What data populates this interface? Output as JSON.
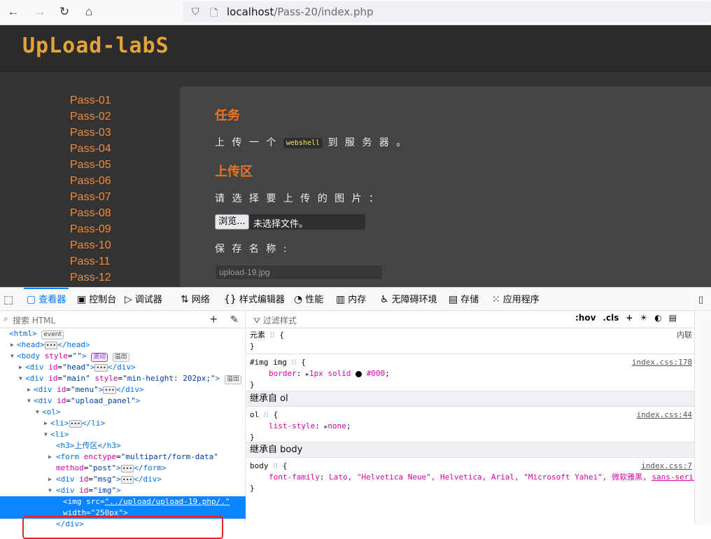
{
  "browser": {
    "url_host": "localhost",
    "url_path": "/Pass-20/index.php"
  },
  "site": {
    "logo": "UpLoad-labS",
    "menu": [
      "Pass-01",
      "Pass-02",
      "Pass-03",
      "Pass-04",
      "Pass-05",
      "Pass-06",
      "Pass-07",
      "Pass-08",
      "Pass-09",
      "Pass-10",
      "Pass-11",
      "Pass-12"
    ],
    "task_heading": "任务",
    "task_text_before": "上 传 一 个",
    "task_code": "webshell",
    "task_text_after": "到 服 务 器 。",
    "upload_heading": "上传区",
    "choose_label": "请 选 择 要 上 传 的 图 片 ：",
    "browse_button": "浏览...",
    "no_file": "未选择文件。",
    "save_name_label": "保 存 名 称 :",
    "save_name_value": "upload-19.jpg"
  },
  "devtools": {
    "tabs": [
      {
        "icon": "▢",
        "label": "查看器"
      },
      {
        "icon": "▣",
        "label": "控制台"
      },
      {
        "icon": "▷",
        "label": "调试器"
      },
      {
        "icon": "⇅",
        "label": "网络"
      },
      {
        "icon": "{}",
        "label": "样式编辑器"
      },
      {
        "icon": "◔",
        "label": "性能"
      },
      {
        "icon": "▥",
        "label": "内存"
      },
      {
        "icon": "♿",
        "label": "无障碍环境"
      },
      {
        "icon": "▤",
        "label": "存储"
      },
      {
        "icon": "⁙",
        "label": "应用程序"
      }
    ],
    "search_placeholder": "搜索 HTML",
    "filter_placeholder": "过滤样式",
    "filter_hov": ":hov",
    "filter_cls": ".cls",
    "tree": {
      "html_tag": "<html>",
      "event_badge": "event",
      "head_open": "<head>",
      "head_close": "</head>",
      "body_open": "<body",
      "body_attr": "style",
      "body_val": "\"\"",
      "body_gt": ">",
      "scroll_badge": "滚动",
      "overflow_badge": "溢出",
      "div": "<div",
      "id_attr": "id",
      "style_attr": "style",
      "head_val": "\"head\"",
      "div_close": "</div>",
      "main_val": "\"main\"",
      "main_style": "\"min-height: 202px;\"",
      "menu_val": "\"menu\"",
      "upload_val": "\"upload_panel\"",
      "ol": "<ol>",
      "li": "<li>",
      "li_close": "</li>",
      "h3": "<h3>上传区</h3>",
      "form_open": "<form",
      "enctype_attr": "enctype",
      "enctype_val": "\"multipart/form-data\"",
      "method_attr": "method",
      "method_val": "\"post\"",
      "form_close": "</form>",
      "msg_val": "\"msg\"",
      "img_val": "\"img\"",
      "img_open": "<img",
      "src_attr": "src",
      "src_val": "\"../upload/upload-19.php/.\"",
      "width_attr": "width",
      "width_val": "\"250px\"",
      "close_div": "</div>"
    },
    "rules": {
      "element_sel": "元素",
      "element_src": "内联",
      "img_sel": "#img img",
      "img_src": "index.css:178",
      "img_prop": "border",
      "img_val": "1px solid",
      "img_color": "#000",
      "inherit_ol": "继承自 ol",
      "ol_sel": "ol",
      "ol_src": "index.css:44",
      "ol_prop": "list-style",
      "ol_val": "none",
      "inherit_body": "继承自 body",
      "body_sel": "body",
      "body_src": "index.css:7",
      "body_prop": "font-family",
      "body_val": "Lato, \"Helvetica Neue\", Helvetica, Arial, \"Microsoft Yahei\", 微软雅黑,",
      "body_val2": "sans-serif"
    }
  }
}
